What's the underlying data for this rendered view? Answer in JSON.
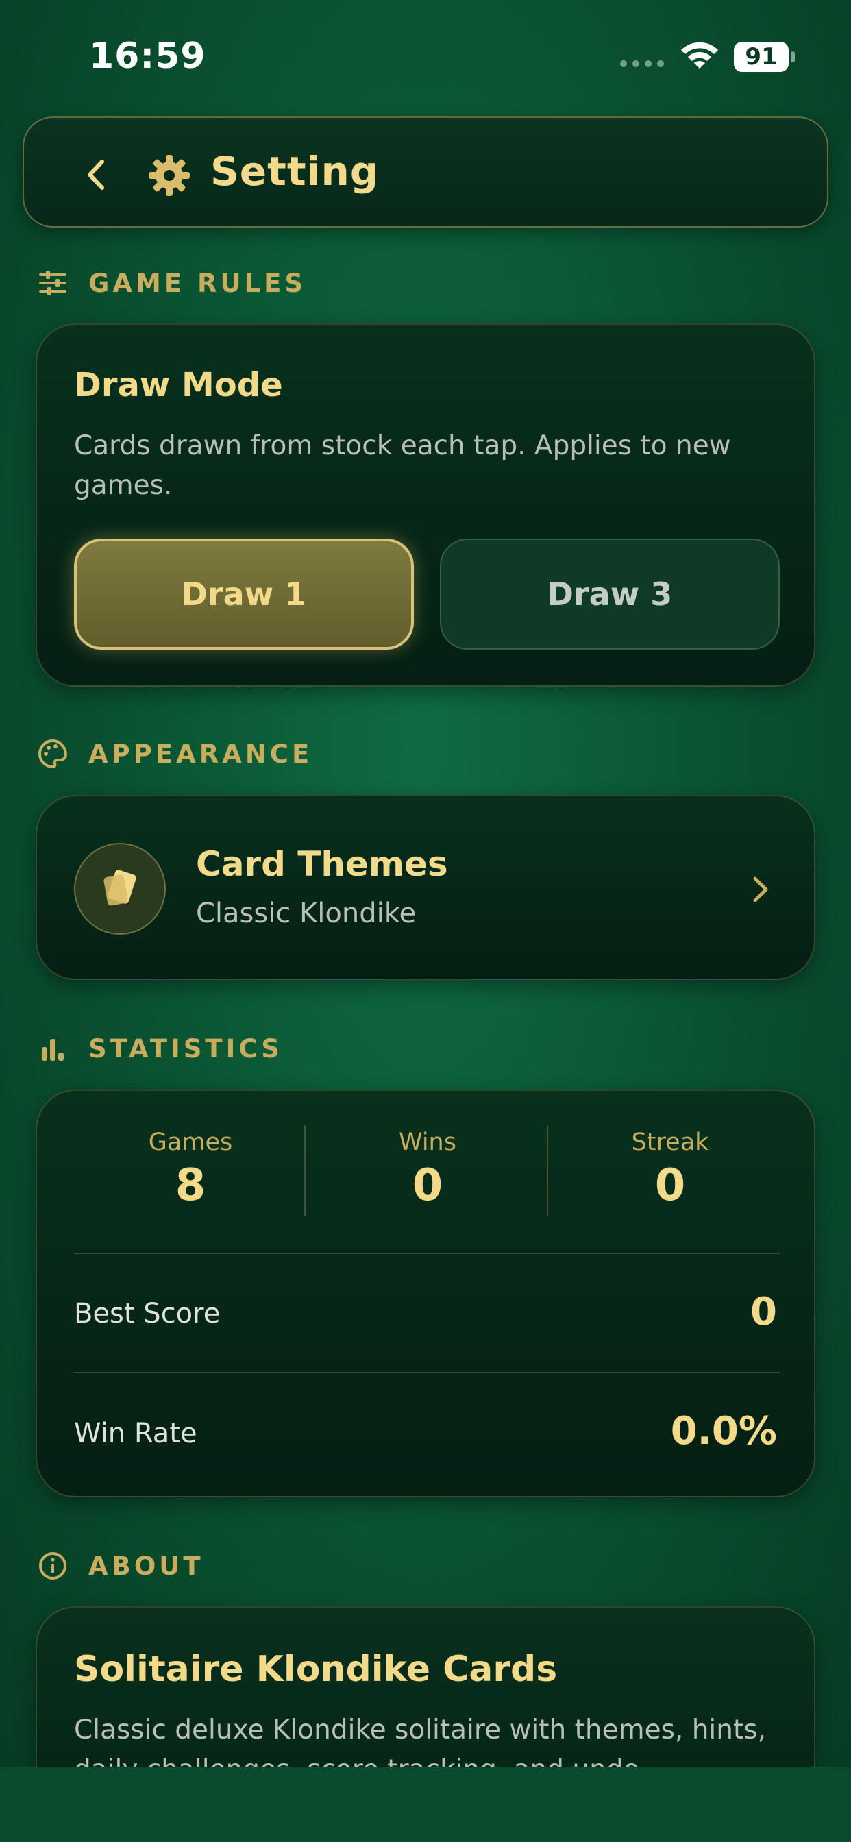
{
  "status_bar": {
    "time": "16:59",
    "battery": "91"
  },
  "header": {
    "title": "Setting"
  },
  "sections": {
    "game_rules": "GAME RULES",
    "appearance": "APPEARANCE",
    "statistics": "STATISTICS",
    "about": "ABOUT"
  },
  "draw_mode": {
    "title": "Draw Mode",
    "description": "Cards drawn from stock each tap. Applies to new games.",
    "options": [
      "Draw 1",
      "Draw 3"
    ],
    "selected": "Draw 1"
  },
  "card_themes": {
    "title": "Card Themes",
    "current": "Classic Klondike"
  },
  "statistics": {
    "games_label": "Games",
    "games_value": "8",
    "wins_label": "Wins",
    "wins_value": "0",
    "streak_label": "Streak",
    "streak_value": "0",
    "best_score_label": "Best Score",
    "best_score_value": "0",
    "win_rate_label": "Win Rate",
    "win_rate_value": "0.0%"
  },
  "about": {
    "title": "Solitaire Klondike Cards",
    "description": "Classic deluxe Klondike solitaire with themes, hints, daily challenges, score tracking, and undo."
  },
  "colors": {
    "accent_gold": "#f3d98a",
    "section_gold": "#c9ad5e",
    "felt_green": "#0b5a36"
  }
}
